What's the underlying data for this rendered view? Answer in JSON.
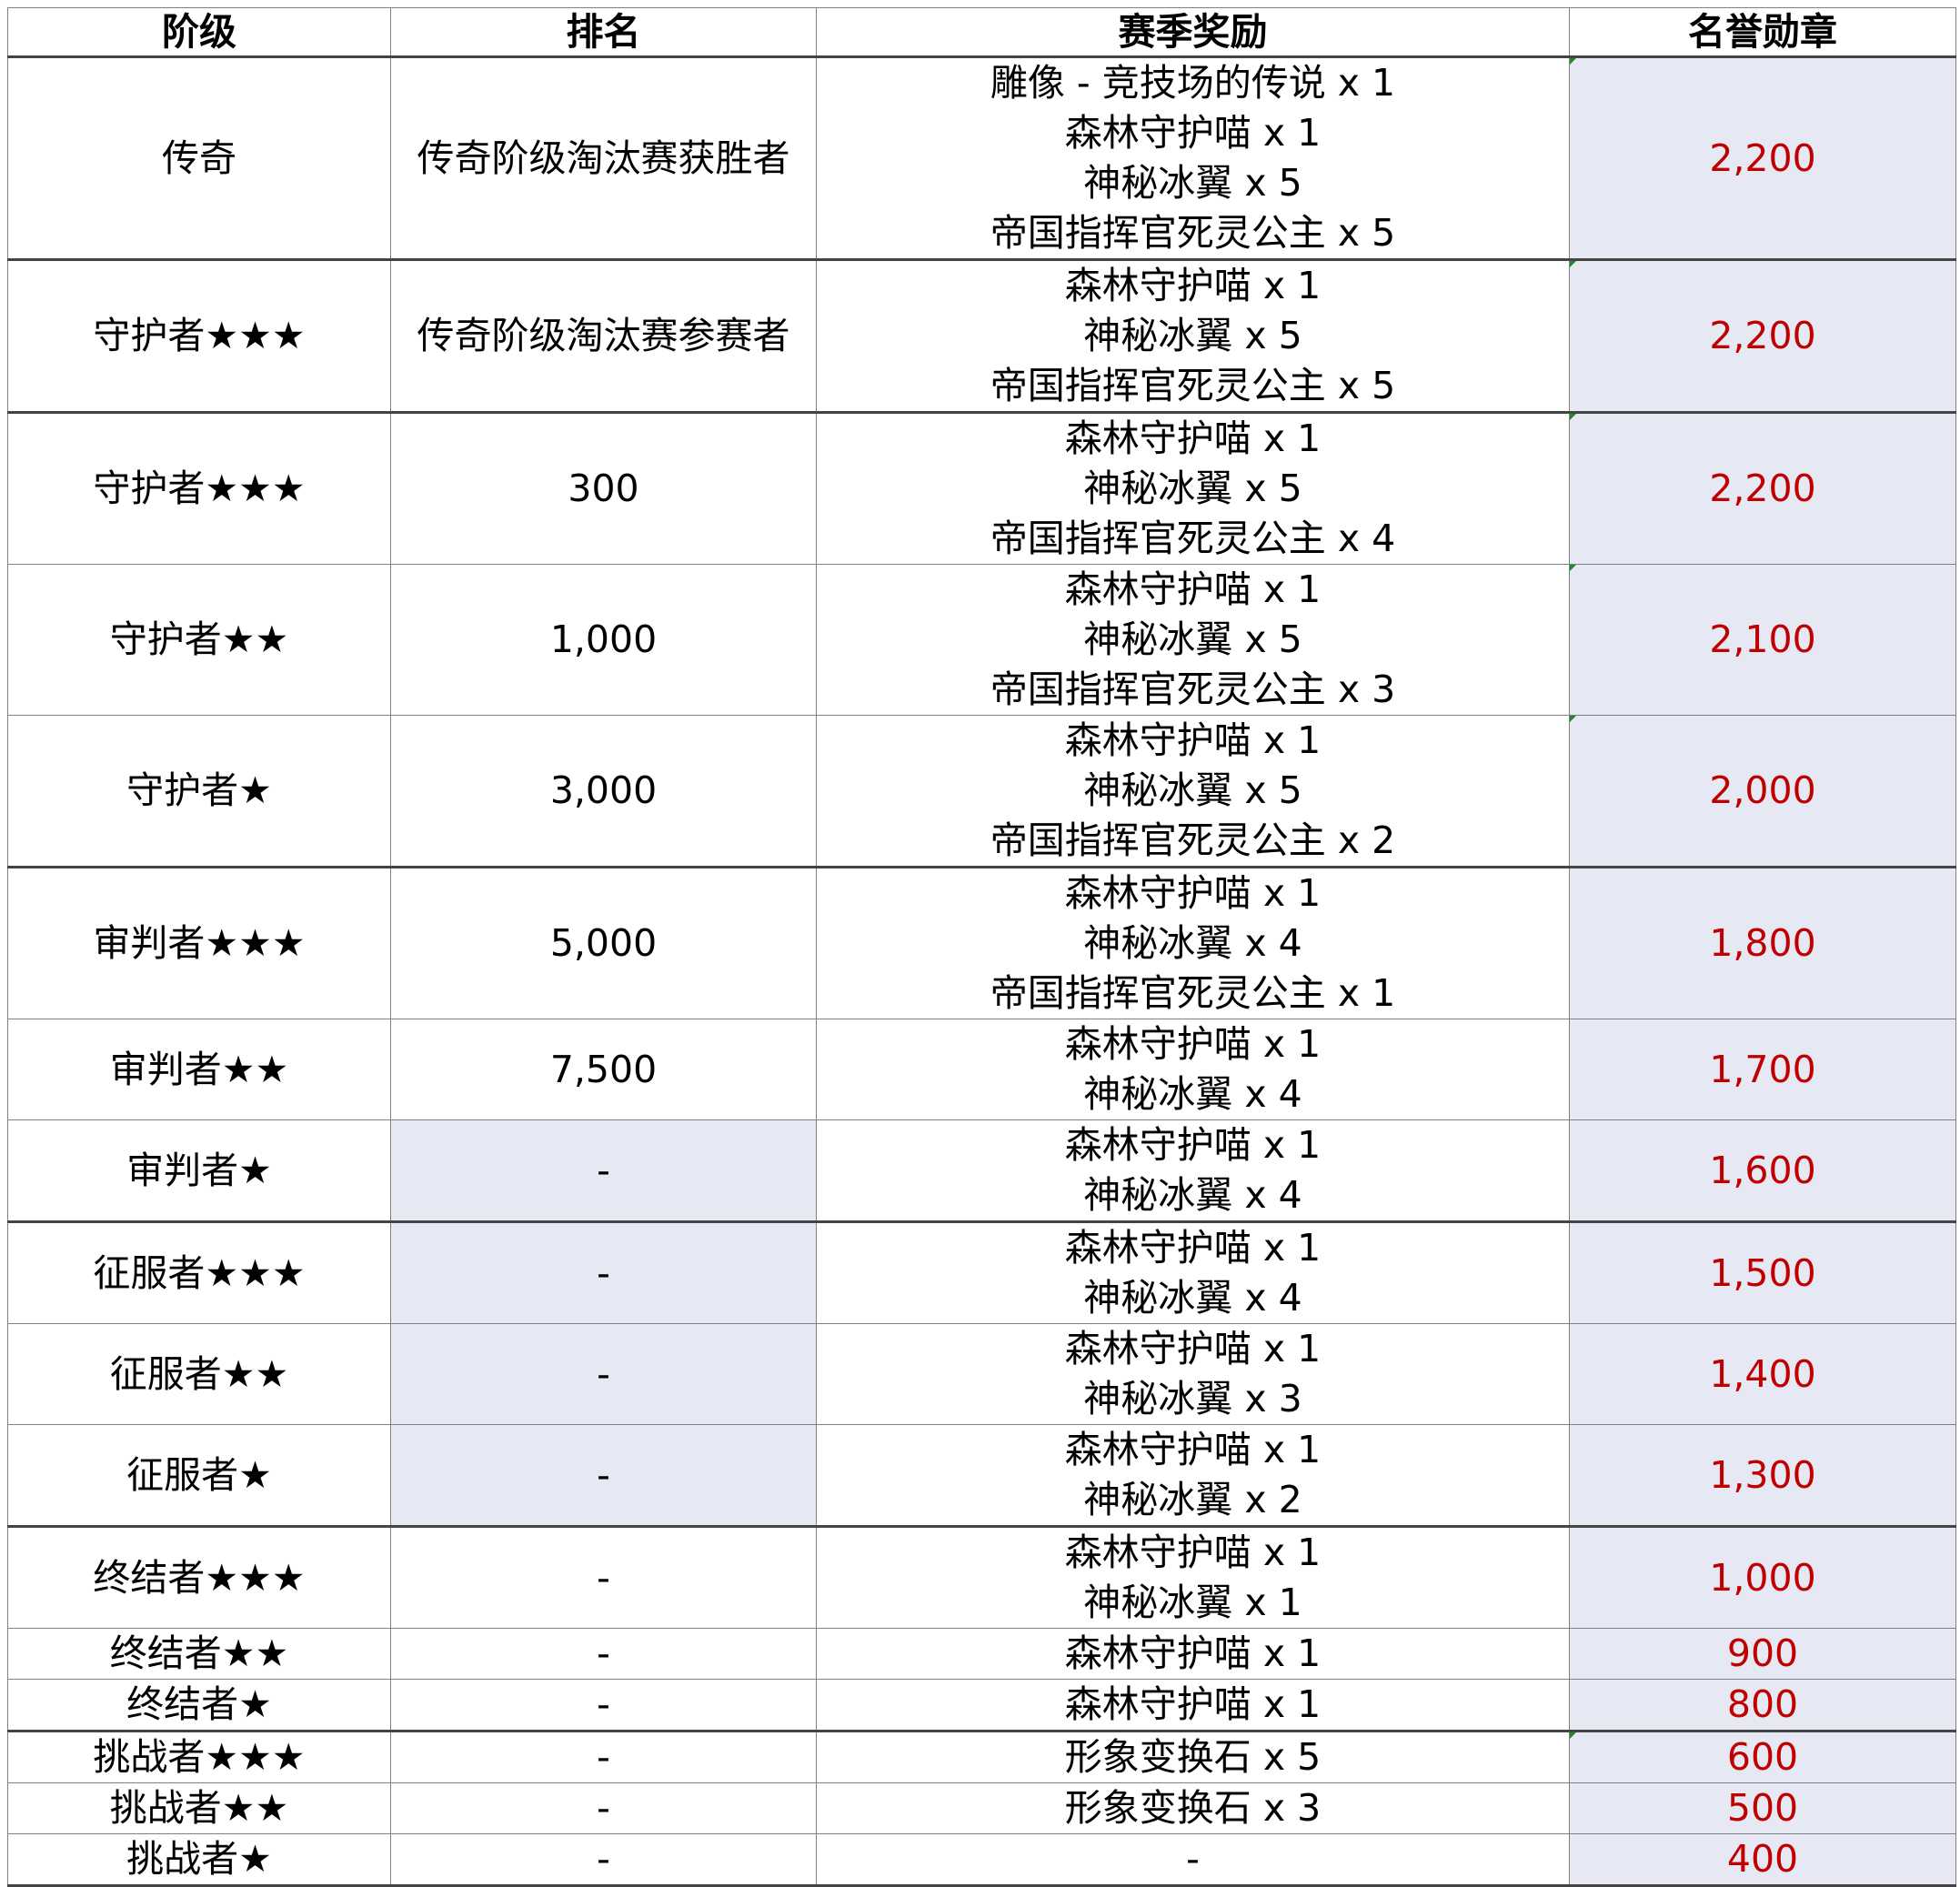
{
  "headers": {
    "tier": "阶级",
    "rank": "排名",
    "rewards": "赛季奖励",
    "medals": "名誉勋章"
  },
  "colors": {
    "medal_text": "#c00000",
    "shaded_cell": "#e6e9f4",
    "corner_mark": "#1f8a2a"
  },
  "rows": [
    {
      "tier": "传奇",
      "rank": "传奇阶级淘汰赛获胜者",
      "rank_shaded": false,
      "rewards": [
        "雕像 - 竞技场的传说 x 1",
        "森林守护喵 x 1",
        "神秘冰翼 x 5",
        "帝国指挥官死灵公主 x 5"
      ],
      "medals": "2,200",
      "group_start": true,
      "marked": true
    },
    {
      "tier": "守护者★★★",
      "rank": "传奇阶级淘汰赛参赛者",
      "rank_shaded": false,
      "rewards": [
        "森林守护喵 x 1",
        "神秘冰翼 x 5",
        "帝国指挥官死灵公主 x 5"
      ],
      "medals": "2,200",
      "group_start": true,
      "marked": true
    },
    {
      "tier": "守护者★★★",
      "rank": "300",
      "rank_shaded": false,
      "rewards": [
        "森林守护喵 x 1",
        "神秘冰翼 x 5",
        "帝国指挥官死灵公主 x 4"
      ],
      "medals": "2,200",
      "group_start": true,
      "marked": true
    },
    {
      "tier": "守护者★★",
      "rank": "1,000",
      "rank_shaded": false,
      "rewards": [
        "森林守护喵 x 1",
        "神秘冰翼 x 5",
        "帝国指挥官死灵公主 x 3"
      ],
      "medals": "2,100",
      "group_start": false,
      "marked": true
    },
    {
      "tier": "守护者★",
      "rank": "3,000",
      "rank_shaded": false,
      "rewards": [
        "森林守护喵 x 1",
        "神秘冰翼 x 5",
        "帝国指挥官死灵公主 x 2"
      ],
      "medals": "2,000",
      "group_start": false,
      "marked": true
    },
    {
      "tier": "审判者★★★",
      "rank": "5,000",
      "rank_shaded": false,
      "rewards": [
        "森林守护喵 x 1",
        "神秘冰翼 x 4",
        "帝国指挥官死灵公主 x 1"
      ],
      "medals": "1,800",
      "group_start": true,
      "marked": false
    },
    {
      "tier": "审判者★★",
      "rank": "7,500",
      "rank_shaded": false,
      "rewards": [
        "森林守护喵 x 1",
        "神秘冰翼 x 4"
      ],
      "medals": "1,700",
      "group_start": false,
      "marked": false
    },
    {
      "tier": "审判者★",
      "rank": "-",
      "rank_shaded": true,
      "rewards": [
        "森林守护喵 x 1",
        "神秘冰翼 x 4"
      ],
      "medals": "1,600",
      "group_start": false,
      "marked": false
    },
    {
      "tier": "征服者★★★",
      "rank": "-",
      "rank_shaded": true,
      "rewards": [
        "森林守护喵 x 1",
        "神秘冰翼 x 4"
      ],
      "medals": "1,500",
      "group_start": true,
      "marked": false
    },
    {
      "tier": "征服者★★",
      "rank": "-",
      "rank_shaded": true,
      "rewards": [
        "森林守护喵 x 1",
        "神秘冰翼 x 3"
      ],
      "medals": "1,400",
      "group_start": false,
      "marked": false
    },
    {
      "tier": "征服者★",
      "rank": "-",
      "rank_shaded": true,
      "rewards": [
        "森林守护喵 x 1",
        "神秘冰翼 x 2"
      ],
      "medals": "1,300",
      "group_start": false,
      "marked": false
    },
    {
      "tier": "终结者★★★",
      "rank": "-",
      "rank_shaded": false,
      "rewards": [
        "森林守护喵 x 1",
        "神秘冰翼 x 1"
      ],
      "medals": "1,000",
      "group_start": true,
      "marked": false
    },
    {
      "tier": "终结者★★",
      "rank": "-",
      "rank_shaded": false,
      "rewards": [
        "森林守护喵 x 1"
      ],
      "medals": "900",
      "group_start": false,
      "marked": false
    },
    {
      "tier": "终结者★",
      "rank": "-",
      "rank_shaded": false,
      "rewards": [
        "森林守护喵 x 1"
      ],
      "medals": "800",
      "group_start": false,
      "marked": false
    },
    {
      "tier": "挑战者★★★",
      "rank": "-",
      "rank_shaded": false,
      "rewards": [
        "形象变换石 x 5"
      ],
      "medals": "600",
      "group_start": true,
      "marked": true
    },
    {
      "tier": "挑战者★★",
      "rank": "-",
      "rank_shaded": false,
      "rewards": [
        "形象变换石 x 3"
      ],
      "medals": "500",
      "group_start": false,
      "marked": false
    },
    {
      "tier": "挑战者★",
      "rank": "-",
      "rank_shaded": false,
      "rewards": [
        "-"
      ],
      "medals": "400",
      "group_start": false,
      "marked": false
    }
  ]
}
